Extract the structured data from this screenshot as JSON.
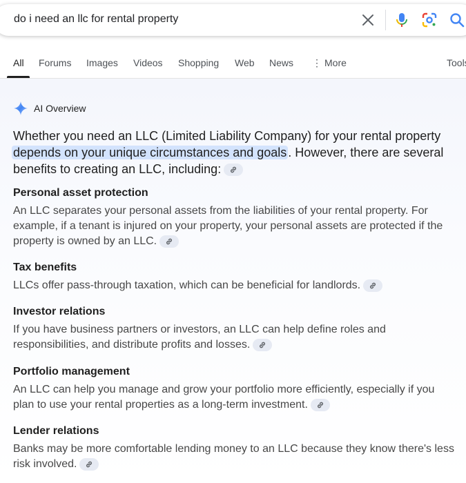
{
  "search": {
    "query": "do i need an llc for rental property"
  },
  "tabs": [
    {
      "label": "All"
    },
    {
      "label": "Forums"
    },
    {
      "label": "Images"
    },
    {
      "label": "Videos"
    },
    {
      "label": "Shopping"
    },
    {
      "label": "Web"
    },
    {
      "label": "News"
    },
    {
      "label": "More"
    },
    {
      "label": "Tools"
    }
  ],
  "overview": {
    "title": "AI Overview",
    "intro_before": "Whether you need an LLC (Limited Liability Company) for your rental property ",
    "intro_highlight": "depends on your unique circumstances and goals",
    "intro_after": ". However, there are several benefits to creating an LLC, including:",
    "sections": [
      {
        "title": "Personal asset protection",
        "body": "An LLC separates your personal assets from the liabilities of your rental property. For example, if a tenant is injured on your property, your personal assets are protected if the property is owned by an LLC."
      },
      {
        "title": "Tax benefits",
        "body": "LLCs offer pass-through taxation, which can be beneficial for landlords."
      },
      {
        "title": "Investor relations",
        "body": "If you have business partners or investors, an LLC can help define roles and responsibilities, and distribute profits and losses."
      },
      {
        "title": "Portfolio management",
        "body": "An LLC can help you manage and grow your portfolio more efficiently, especially if you plan to use your rental properties as a long-term investment."
      },
      {
        "title": "Lender relations",
        "body": "Banks may be more comfortable lending money to an LLC because they know there's less risk involved."
      }
    ]
  },
  "icons": {
    "clear": "close-icon",
    "mic": "microphone-icon",
    "lens": "lens-icon",
    "search": "search-icon",
    "spark": "sparkle-icon",
    "cite": "link-icon"
  },
  "colors": {
    "highlight": "#d3e3fd",
    "accent_blue": "#4285f4"
  }
}
